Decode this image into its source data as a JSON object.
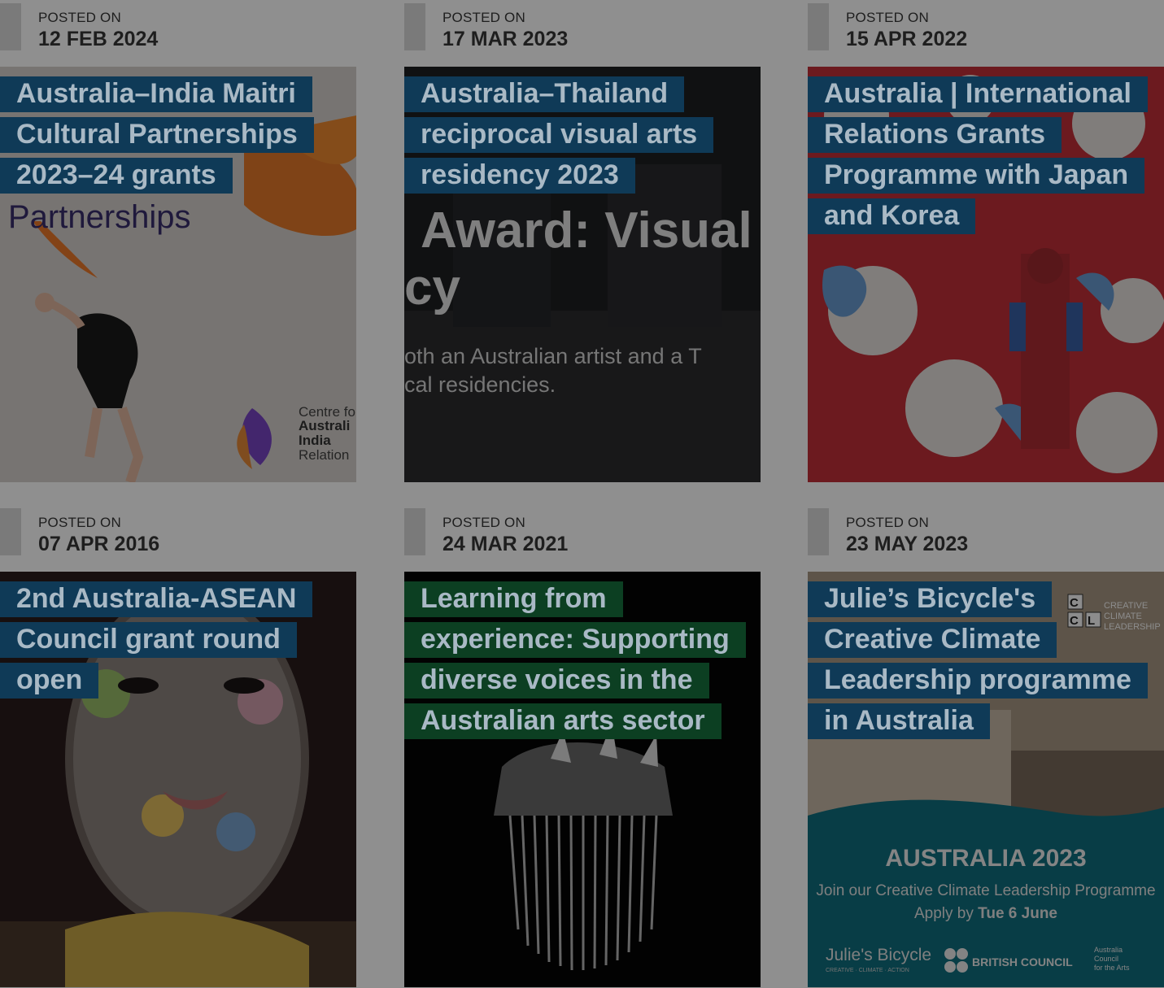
{
  "posts": [
    {
      "label": "POSTED ON",
      "date": "12 FEB 2024",
      "title": "Australia–India Maitri Cultural Partnerships 2023–24 grants",
      "image_text": {
        "main": "Partnerships",
        "org_1": "Centre fo",
        "org_2": "Australi",
        "org_3": "India",
        "org_4": "Relation"
      },
      "title_bg": "#0f3a57"
    },
    {
      "label": "POSTED ON",
      "date": "17 MAR 2023",
      "title": "Australia–Thailand reciprocal visual arts residency 2023",
      "image_text": {
        "line1": "Award: Visual",
        "line2": "cy",
        "line3": "oth an Australian artist and a T",
        "line4": "cal residencies."
      },
      "title_bg": "#0f3a57"
    },
    {
      "label": "POSTED ON",
      "date": "15 APR 2022",
      "title": "Australia | International Relations Grants Programme with Japan and Korea",
      "title_bg": "#0f3a57"
    },
    {
      "label": "POSTED ON",
      "date": "07 APR 2016",
      "title": "2nd Australia-ASEAN Council grant round open",
      "title_bg": "#0f3a57"
    },
    {
      "label": "POSTED ON",
      "date": "24 MAR 2021",
      "title": "Learning from experience: Supporting diverse voices in the Australian arts sector",
      "title_bg": "#0c3f22"
    },
    {
      "label": "POSTED ON",
      "date": "23 MAY 2023",
      "title": "Julie’s Bicycle's Creative Climate Leadership programme in Australia",
      "image_text": {
        "ccl_1": "CREATIVE",
        "ccl_2": "CLIMATE",
        "ccl_3": "LEADERSHIP",
        "headline": "AUSTRALIA 2023",
        "sub1": "Join our Creative Climate Leadership Programme",
        "sub2a": "Apply by ",
        "sub2b": "Tue 6 June",
        "logo1": "Julie's Bicycle",
        "logo1_sub": "CREATIVE · CLIMATE · ACTION",
        "logo2": "BRITISH COUNCIL",
        "logo3a": "Australia",
        "logo3b": "Council",
        "logo3c": "for the Arts"
      },
      "title_bg": "#0f3a57"
    }
  ],
  "colors": {
    "overlay": "rgba(0,0,0,0.45)",
    "page_bg": "#8f8f8f"
  }
}
